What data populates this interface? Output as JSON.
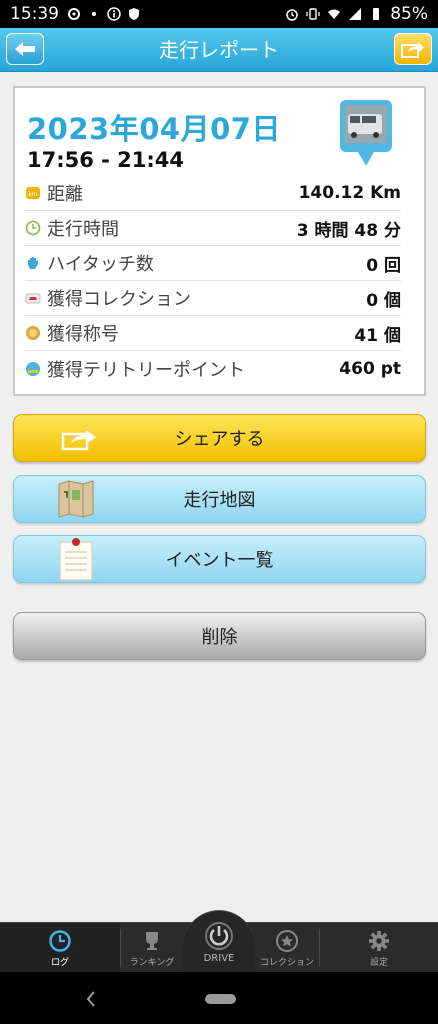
{
  "status_bar": {
    "time": "15:39",
    "battery": "85%"
  },
  "header": {
    "title": "走行レポート",
    "back_icon": "back-arrow-icon",
    "export_icon": "share-export-icon",
    "accent_color": "#29a9dc"
  },
  "report": {
    "date": "2023年04月07日",
    "time_range": "17:56 - 21:44",
    "stats": [
      {
        "label": "距離",
        "value": "140.12 Km",
        "icon": "km-icon"
      },
      {
        "label": "走行時間",
        "value": "3 時間 48 分",
        "icon": "clock-icon"
      },
      {
        "label": "ハイタッチ数",
        "value": "0 回",
        "icon": "hand-icon"
      },
      {
        "label": "獲得コレクション",
        "value": "0 個",
        "icon": "car-collection-icon"
      },
      {
        "label": "獲得称号",
        "value": "41 個",
        "icon": "medal-icon"
      },
      {
        "label": "獲得テリトリーポイント",
        "value": "460 pt",
        "icon": "territory-icon"
      }
    ]
  },
  "actions": {
    "share": "シェアする",
    "map": "走行地図",
    "events": "イベント一覧",
    "delete": "削除"
  },
  "tabbar": {
    "log": "ログ",
    "ranking": "ランキング",
    "drive": "DRIVE",
    "collection": "コレクション",
    "settings": "設定"
  }
}
